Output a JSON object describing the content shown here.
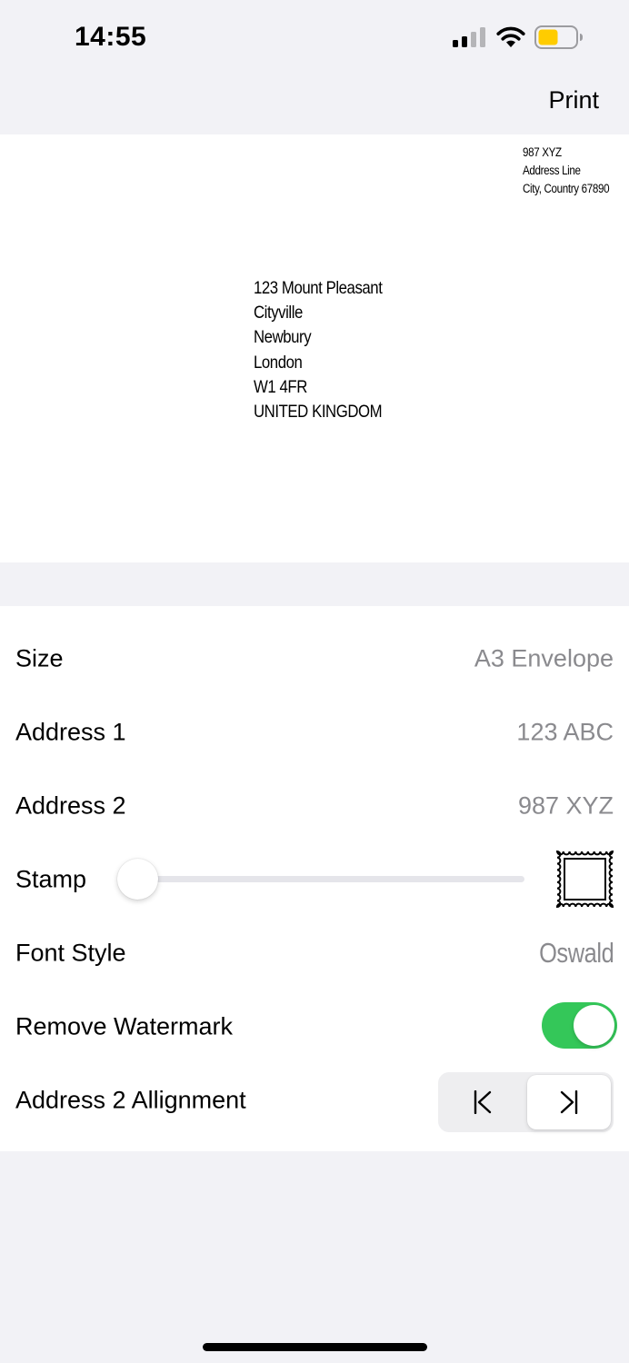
{
  "status_bar": {
    "time": "14:55",
    "icons": [
      "cellular-signal-icon",
      "wifi-icon",
      "battery-icon"
    ],
    "battery_color": "#ffcc00"
  },
  "nav": {
    "print_label": "Print"
  },
  "preview": {
    "return_address": [
      "987 XYZ",
      "Address Line",
      "City, Country 67890"
    ],
    "recipient_address": [
      "123 Mount Pleasant",
      "Cityville",
      "Newbury",
      "London",
      "W1 4FR",
      "UNITED KINGDOM"
    ]
  },
  "settings": {
    "size": {
      "label": "Size",
      "value": "A3 Envelope"
    },
    "address1": {
      "label": "Address 1",
      "value": "123 ABC"
    },
    "address2": {
      "label": "Address 2",
      "value": "987 XYZ"
    },
    "stamp": {
      "label": "Stamp",
      "slider_value": 0,
      "icon": "postage-stamp-icon"
    },
    "font_style": {
      "label": "Font Style",
      "value": "Oswald"
    },
    "remove_watermark": {
      "label": "Remove Watermark",
      "on": true,
      "color": "#34c759"
    },
    "alignment": {
      "label": "Address 2 Allignment",
      "options": [
        "align-left-icon",
        "align-right-icon"
      ],
      "selected": "align-right-icon"
    }
  }
}
